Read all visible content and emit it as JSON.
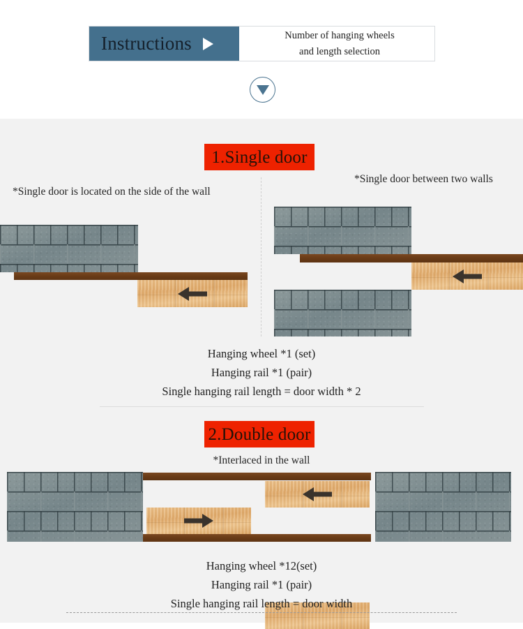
{
  "header": {
    "tab_label": "Instructions",
    "play_icon": "play-triangle-icon",
    "desc_line1": "Number of hanging wheels",
    "desc_line2": "and length selection",
    "scroll_icon": "chevron-down-circle-icon",
    "accent_color": "#44708d"
  },
  "sections": [
    {
      "banner": "1.Single door",
      "banner_color": "#ee2200",
      "caption_left": "*Single door is located on the side of the wall",
      "caption_right": "*Single door between two walls",
      "arrow_left_diagram": "arrow-left-icon",
      "arrow_right_diagram": "arrow-left-icon",
      "specs": [
        "Hanging wheel *1 (set)",
        "Hanging rail *1 (pair)",
        "Single hanging rail length = door width * 2"
      ]
    },
    {
      "banner": "2.Double door",
      "banner_color": "#ee2200",
      "caption": "*Interlaced in the wall",
      "arrow_left_door": "arrow-right-icon",
      "arrow_right_door": "arrow-left-icon",
      "specs": [
        "Hanging wheel *12(set)",
        "Hanging rail *1 (pair)",
        "Single hanging rail length = door width"
      ]
    }
  ]
}
